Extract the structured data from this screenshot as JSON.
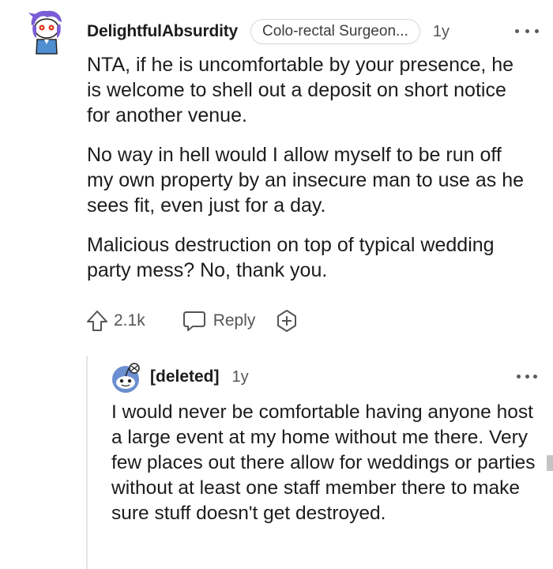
{
  "comment": {
    "username": "DelightfulAbsurdity",
    "flair": "Colo-rectal Surgeon...",
    "age": "1y",
    "paragraphs": [
      "NTA, if he is uncomfortable by your presence, he is welcome to shell out a deposit on short notice for another venue.",
      "No way in hell would I allow myself to be run off my own property by an insecure man to use as he sees fit, even just for a day.",
      "Malicious destruction on top of typical wedding party mess? No, thank you."
    ],
    "upvote_count": "2.1k",
    "reply_label": "Reply",
    "icons": {
      "avatar": "snoo-avatar-purple-hair",
      "more": "more-options-icon",
      "upvote": "upvote-arrow-icon",
      "reply": "reply-bubble-icon",
      "award": "award-plus-icon"
    }
  },
  "reply": {
    "username": "[deleted]",
    "age": "1y",
    "body": "I would never be comfortable having anyone host a large event at my home without me there. Very few places out there allow for weddings or parties without at least one staff member there to make sure stuff doesn't get destroyed.",
    "icons": {
      "avatar": "default-snoo-avatar",
      "more": "more-options-icon"
    }
  },
  "colors": {
    "text": "#1c1c1c",
    "muted": "#555555",
    "avatar_purple": "#7b5cd6",
    "avatar_blue": "#4f8fd1",
    "avatar_red": "#e03a1e"
  }
}
